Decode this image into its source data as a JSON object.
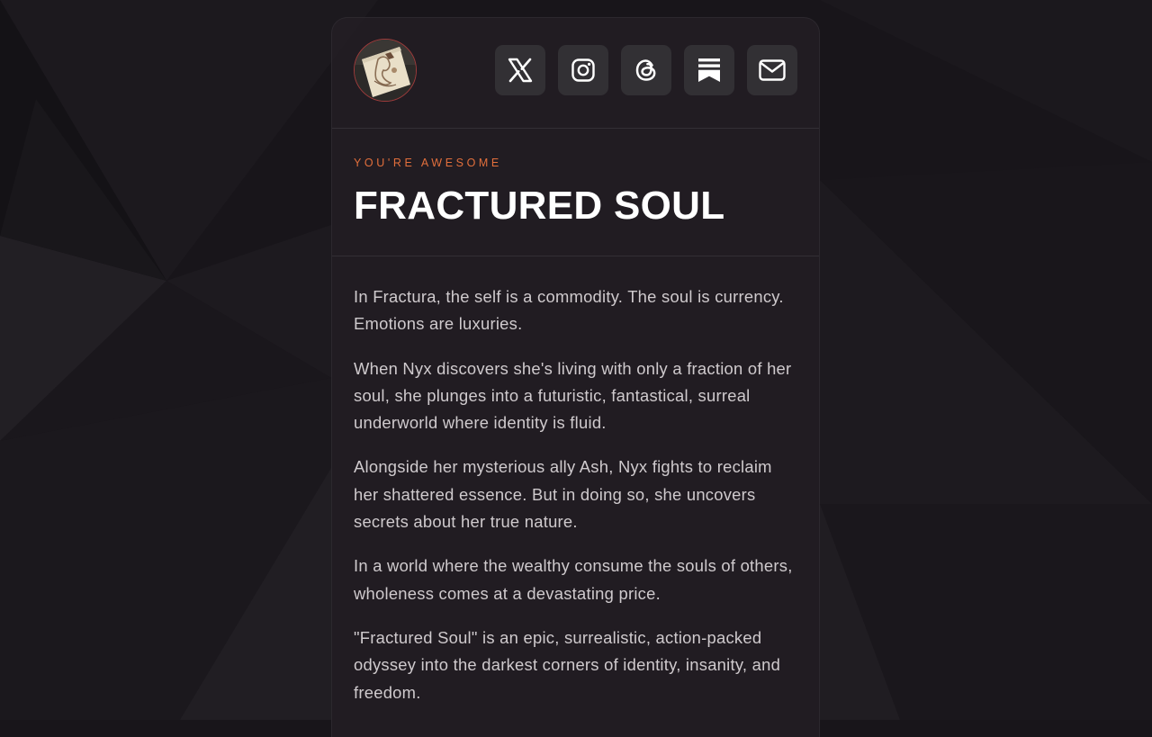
{
  "header": {
    "avatar_alt": "profile avatar",
    "socials": [
      {
        "name": "x-twitter-icon",
        "button": "social-x-button"
      },
      {
        "name": "instagram-icon",
        "button": "social-instagram-button"
      },
      {
        "name": "threads-icon",
        "button": "social-threads-button"
      },
      {
        "name": "substack-icon",
        "button": "social-substack-button"
      },
      {
        "name": "email-icon",
        "button": "social-email-button"
      }
    ]
  },
  "hero": {
    "eyebrow": "YOU'RE AWESOME",
    "title": "FRACTURED SOUL"
  },
  "description": [
    "In Fractura, the self is a commodity. The soul is currency. Emotions are luxuries.",
    "When Nyx discovers she's living with only a fraction of her soul, she plunges into a futuristic, fantastical, surreal underworld where identity is fluid.",
    "Alongside her mysterious ally Ash, Nyx fights to reclaim her shattered essence. But in doing so, she uncovers secrets about her true nature.",
    "In a world where the wealthy consume the souls of others, wholeness comes at a devastating price.",
    "\"Fractured Soul\" is an epic, surrealistic, action-packed odyssey into the darkest corners of identity, insanity, and freedom."
  ],
  "colors": {
    "background": "#18151a",
    "card": "#231f25",
    "accent": "#e26f3c",
    "title": "#ffffff",
    "text": "#cfcacd",
    "icon_button": "#323034"
  }
}
